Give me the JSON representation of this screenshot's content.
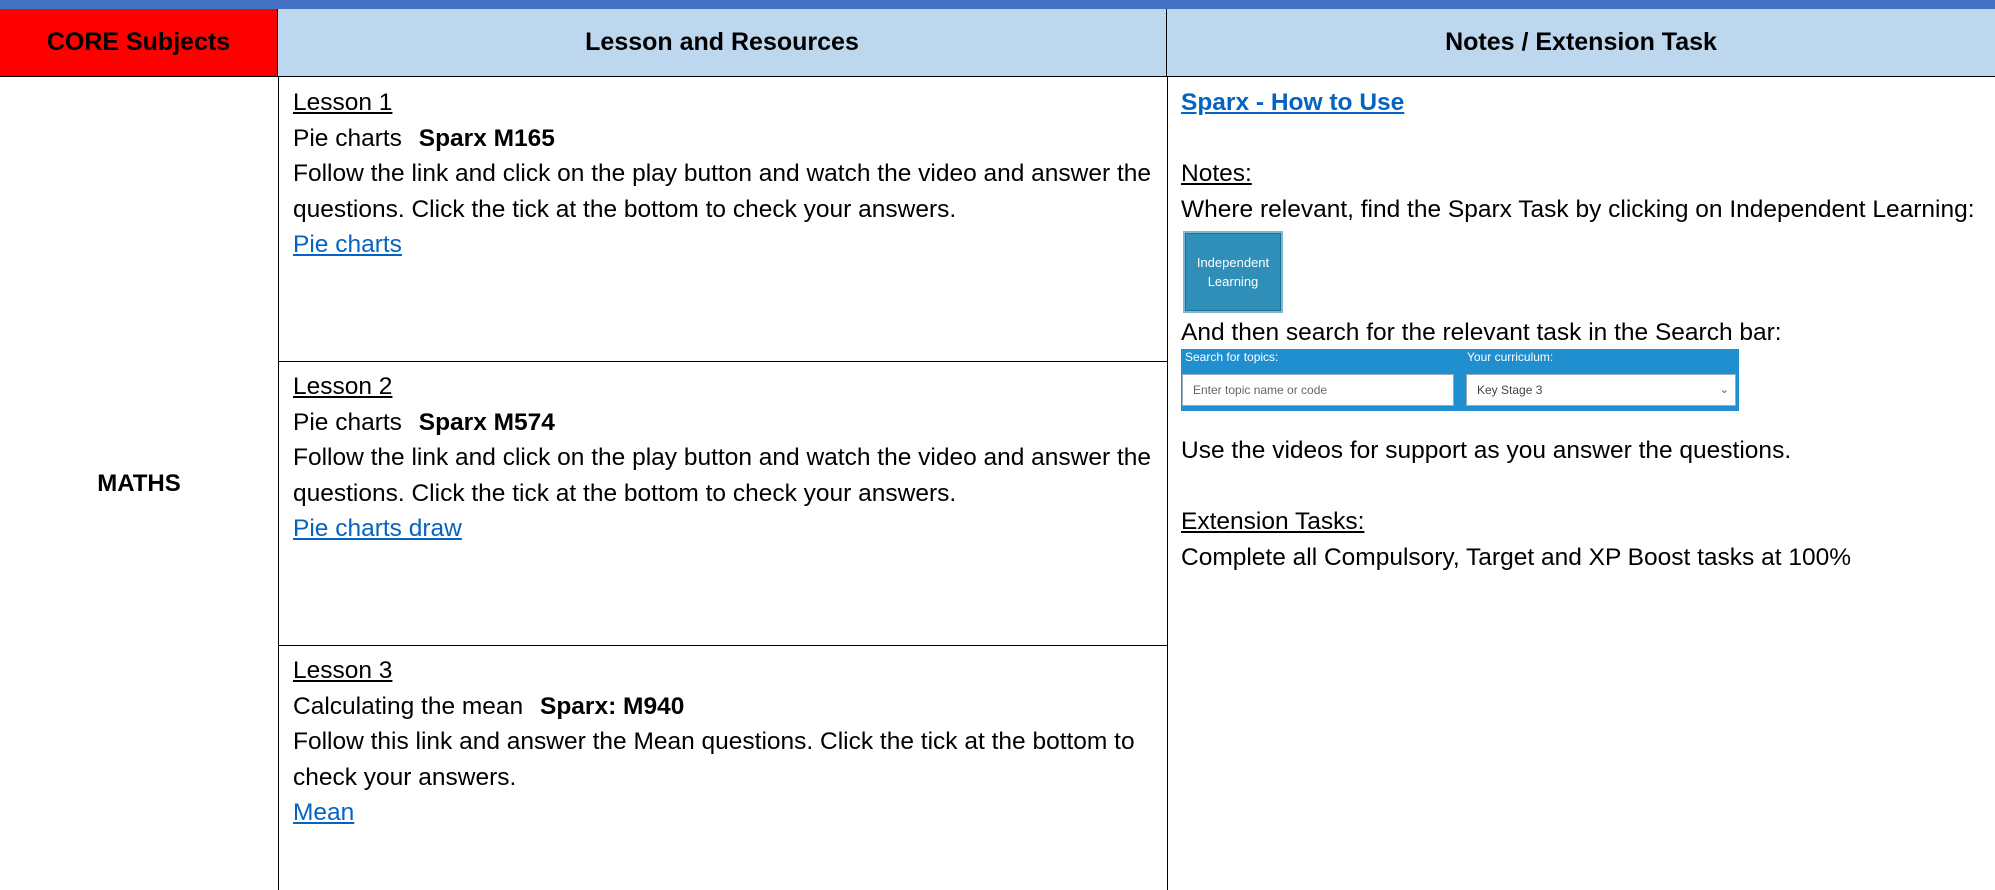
{
  "header": {
    "core": "CORE Subjects",
    "lesson": "Lesson and Resources",
    "notes": "Notes / Extension Task"
  },
  "subject": "MATHS",
  "lessons": [
    {
      "title": "Lesson 1",
      "topic": "Pie charts",
      "code": "Sparx M165",
      "instructions": "Follow the link and click on the play button and watch the video and answer the questions. Click the tick at the bottom to check your answers.",
      "link": "Pie charts"
    },
    {
      "title": "Lesson 2",
      "topic": "Pie charts",
      "code": "Sparx M574",
      "instructions": "Follow the link and click on the play button and watch the video and answer the questions. Click the tick at the bottom to check your answers.",
      "link": "Pie charts draw"
    },
    {
      "title": "Lesson 3",
      "topic": "Calculating the mean",
      "code": "Sparx: M940",
      "instructions": "Follow this link and answer the Mean questions. Click the tick at the bottom to check your answers.",
      "link": "Mean"
    }
  ],
  "notes": {
    "howto_link": "Sparx - How to Use",
    "notes_heading": "Notes:",
    "notes_text": "Where relevant, find the Sparx Task by clicking on Independent Learning:",
    "il_button": "Independent Learning",
    "search_text": "And then search for the relevant task in the Search bar:",
    "search_label": "Search for topics:",
    "search_placeholder": "Enter topic name or code",
    "curriculum_label": "Your curriculum:",
    "curriculum_value": "Key Stage 3",
    "videos_text": "Use the videos for support as you answer the questions.",
    "extension_heading": "Extension Tasks:",
    "extension_text": "Complete all Compulsory, Target and XP Boost tasks at 100%"
  },
  "colors": {
    "core_header": "#ff0000",
    "header": "#bdd7ee",
    "link": "#0563c1",
    "topbar": "#4472c4"
  }
}
